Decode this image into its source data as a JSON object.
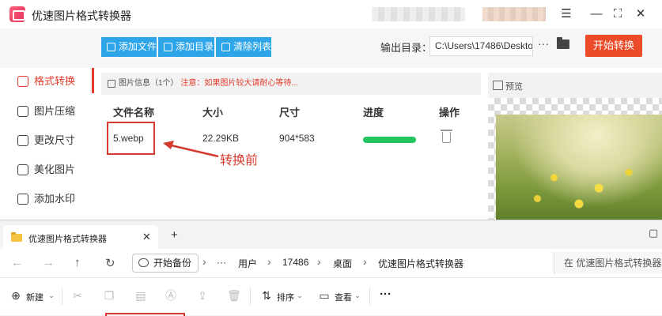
{
  "app": {
    "title": "优速图片格式转换器",
    "min_glyph": "☰",
    "restore_glyph": "—",
    "max_glyph": "⛶",
    "close_glyph": "✕"
  },
  "toolbar": {
    "add_file": "添加文件",
    "add_dir": "添加目录",
    "clear_list": "清除列表",
    "output_label": "输出目录：",
    "output_path": "C:\\Users\\17486\\Deskto",
    "more": "···",
    "start": "开始转换"
  },
  "sidebar": {
    "items": [
      {
        "label": "格式转换",
        "active": true
      },
      {
        "label": "图片压缩"
      },
      {
        "label": "更改尺寸"
      },
      {
        "label": "美化图片"
      },
      {
        "label": "添加水印"
      }
    ]
  },
  "file_panel": {
    "info_title": "图片信息",
    "info_count": "（1个）",
    "info_note": "注意：如果图片较大请耐心等待...",
    "columns": {
      "name": "文件名称",
      "size": "大小",
      "dims": "尺寸",
      "progress": "进度",
      "action": "操作"
    },
    "row": {
      "name": "5.webp",
      "size": "22.29KB",
      "dims": "904*583",
      "progress": 1.0
    }
  },
  "annotation": {
    "text": "转换前"
  },
  "preview": {
    "label": "预览"
  },
  "explorer": {
    "tab_label": "优速图片格式转换器",
    "tab_close": "✕",
    "tab_add": "+",
    "min_glyph": "▢",
    "nav": {
      "back": "←",
      "forward": "→",
      "up": "↑",
      "refresh": "↻"
    },
    "backup": "开始备份",
    "breadcrumb": [
      "···",
      "用户",
      "17486",
      "桌面",
      "优速图片格式转换器"
    ],
    "search_placeholder": "在 优速图片格式转换器",
    "commands": {
      "new": "新建",
      "sort": "排序",
      "view": "查看",
      "more": "···"
    }
  }
}
